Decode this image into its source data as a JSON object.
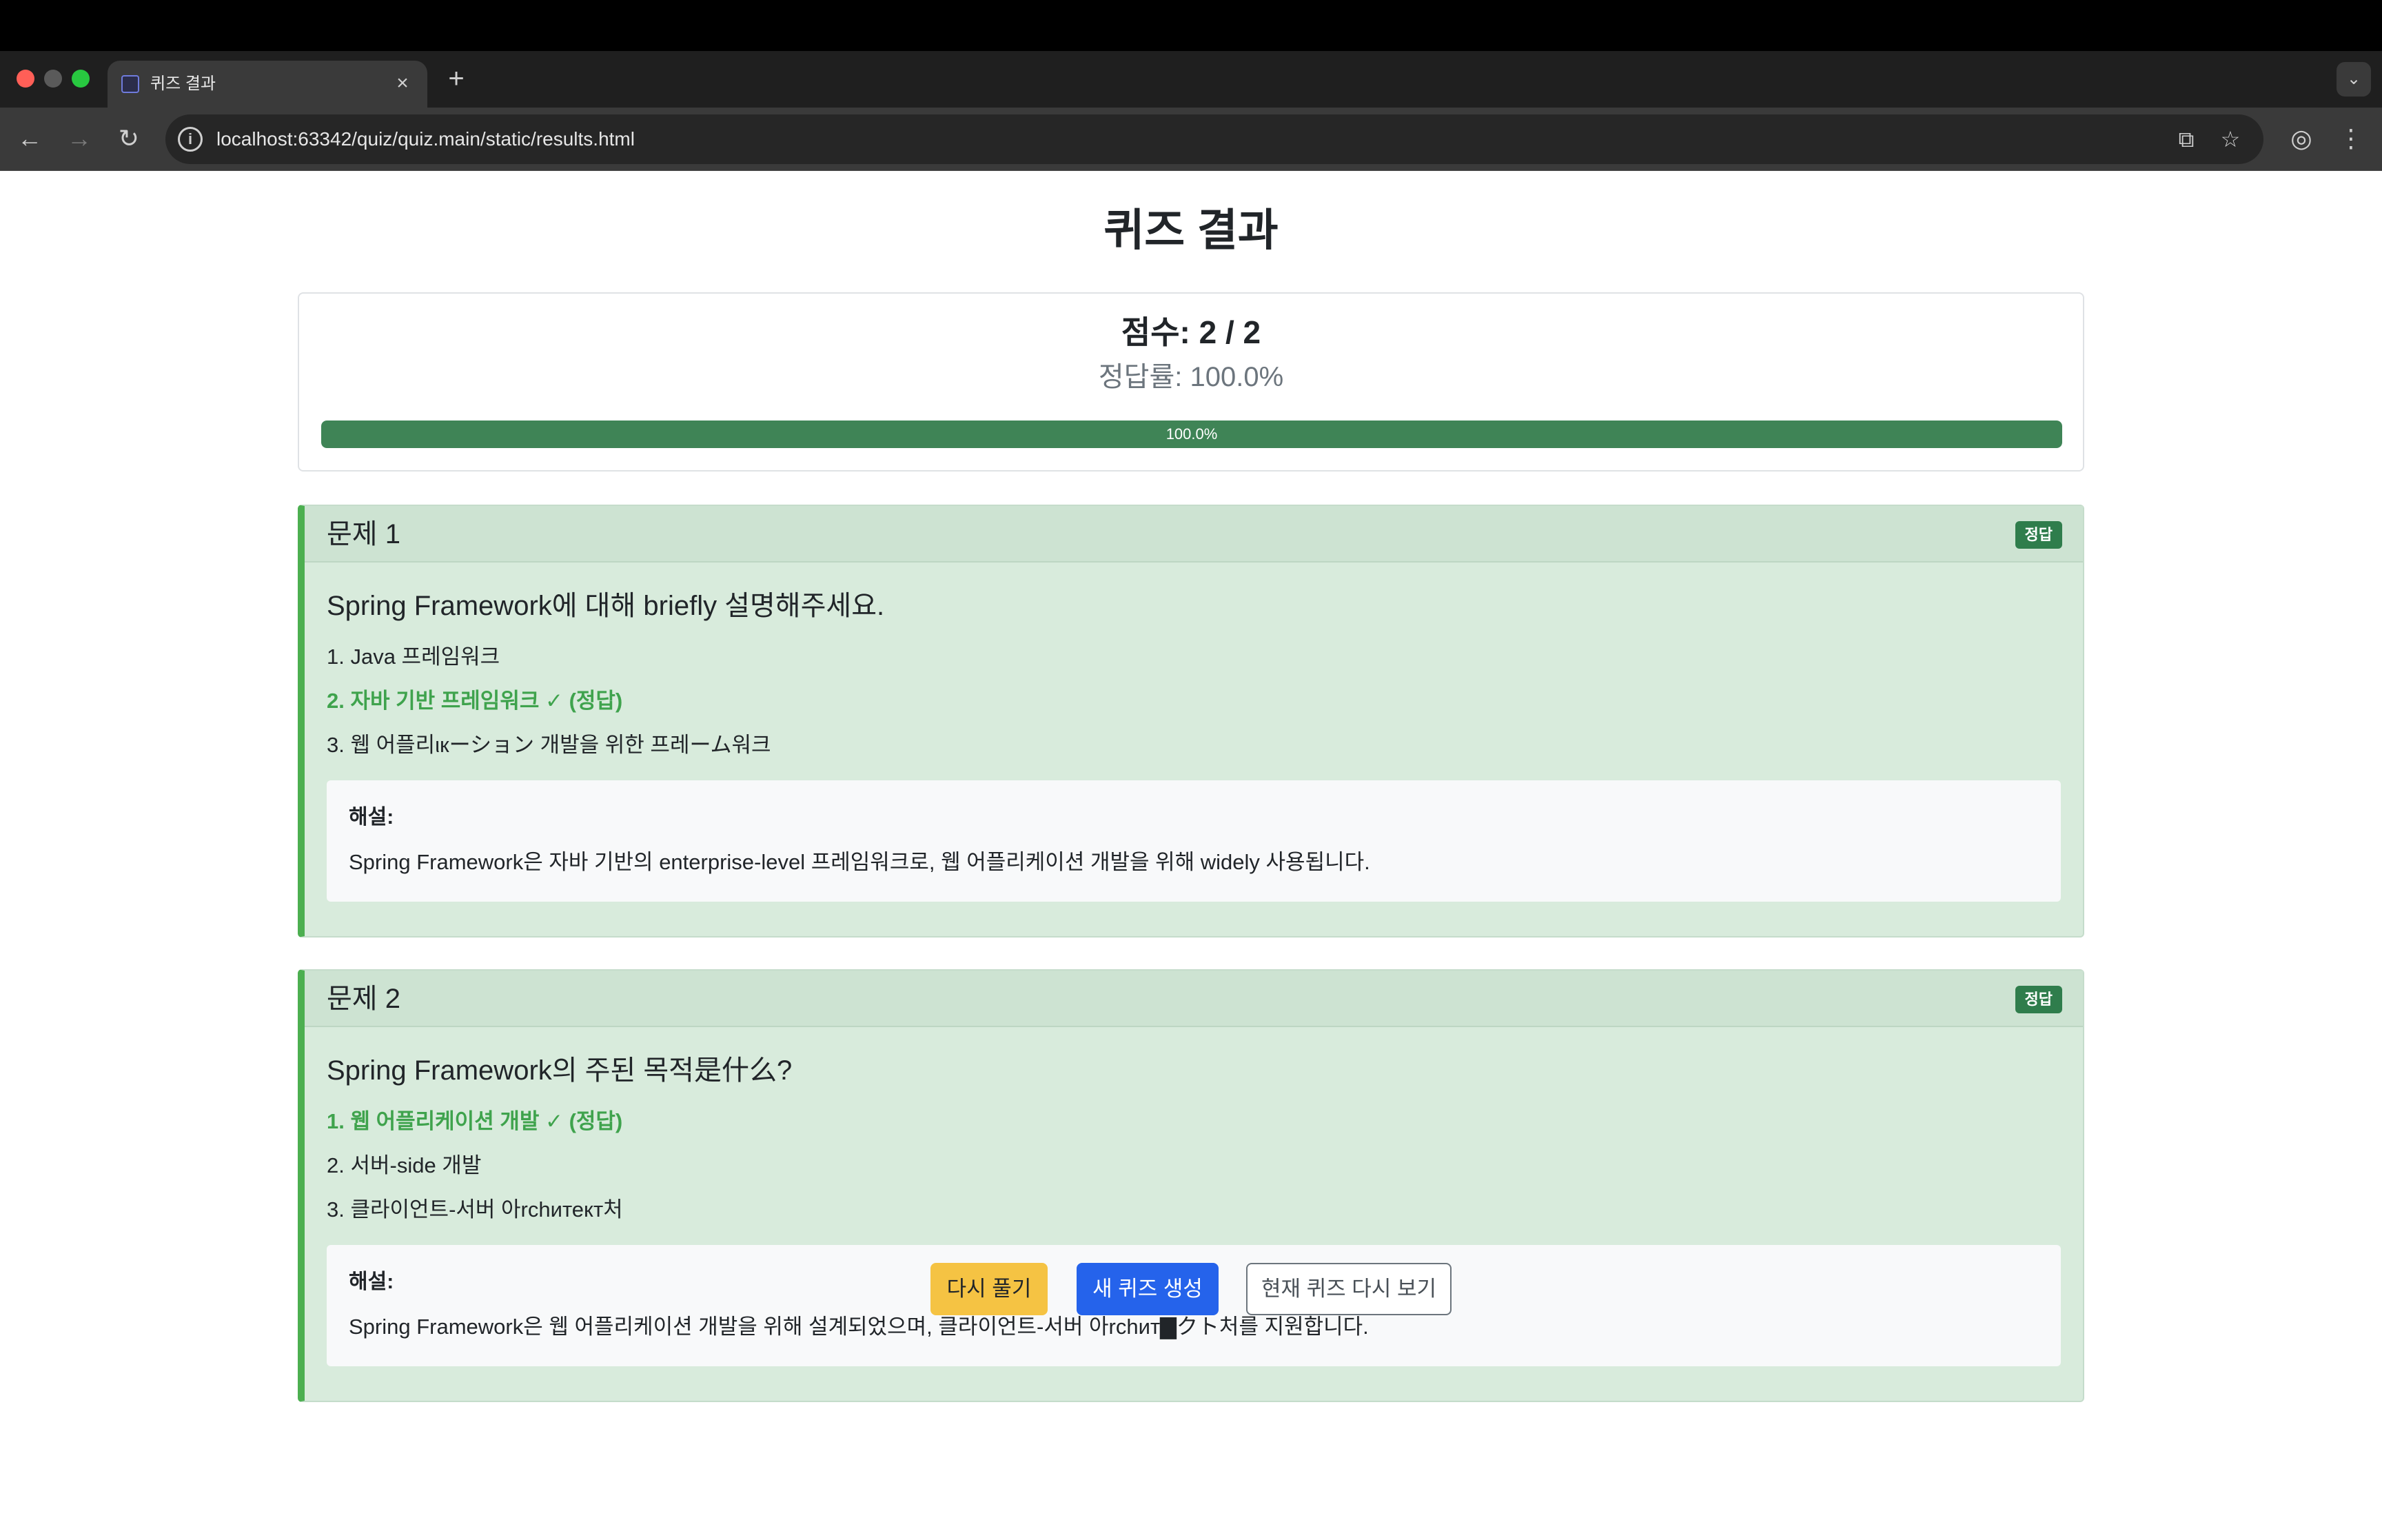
{
  "browser": {
    "tab_title": "퀴즈 결과",
    "tab_close_glyph": "×",
    "new_tab_glyph": "+",
    "tab_menu_glyph": "⌄",
    "url": "localhost:63342/quiz/quiz.main/static/results.html",
    "traffic_lights": {
      "close": "#ff5f57",
      "minimize": "#5a5a5a",
      "maximize": "#28c840"
    },
    "icons": {
      "back": "←",
      "forward": "→",
      "reload": "↻",
      "info": "i",
      "translate": "⧉",
      "bookmark": "☆",
      "profile": "◎",
      "menu": "⋮"
    }
  },
  "page": {
    "title": "퀴즈 결과",
    "score_text": "점수: 2 / 2",
    "rate_text": "정답률: 100.0%",
    "progress": {
      "value": 1.0,
      "label": "100.0%",
      "color": "#3f8456"
    }
  },
  "questions": [
    {
      "header": "문제 1",
      "badge": "정답",
      "text": "Spring Framework에 대해 briefly 설명해주세요.",
      "options": [
        {
          "label": "1. Java 프레임워크",
          "correct": false
        },
        {
          "label": "2. 자바 기반 프레임워크 ✓ (정답)",
          "correct": true
        },
        {
          "label": "3. 웹 어플리ιкーション 개발을 위한 프레ーム워크",
          "correct": false
        }
      ],
      "explanation_title": "해설:",
      "explanation": "Spring Framework은 자바 기반의 enterprise-level 프레임워크로, 웹 어플리케이션 개발을 위해 widely 사용됩니다."
    },
    {
      "header": "문제 2",
      "badge": "정답",
      "text": "Spring Framework의 주된 목적是什么?",
      "options": [
        {
          "label": "1. 웹 어플리케이션 개발 ✓ (정답)",
          "correct": true
        },
        {
          "label": "2. 서버-side 개발",
          "correct": false
        },
        {
          "label": "3. 클라이언트-서버 아rchитект처",
          "correct": false
        }
      ],
      "explanation_title": "해설:",
      "explanation": "Spring Framework은 웹 어플리케이션 개발을 위해 설계되었으며, 클라이언트-서버 아rchит▇クト처를 지원합니다."
    }
  ],
  "actions": {
    "retry": "다시 풀기",
    "new_quiz": "새 퀴즈 생성",
    "review": "현재 퀴즈 다시 보기"
  }
}
